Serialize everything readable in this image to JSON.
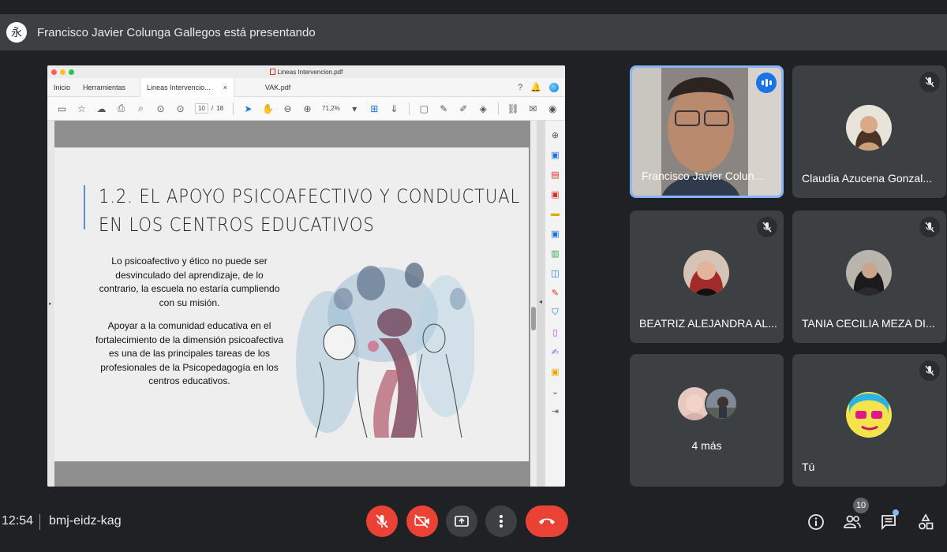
{
  "banner": {
    "presenter_text": "Francisco Javier Colunga Gallegos está presentando",
    "icon_glyph": "永"
  },
  "shared_screen": {
    "window_title": "Lineas Intervencion.pdf",
    "nav": [
      "Inicio",
      "Herramientas"
    ],
    "tabs": [
      {
        "label": "Lineas Intervencio...",
        "close": "×",
        "active": true
      },
      {
        "label": "VAK.pdf",
        "active": false
      }
    ],
    "page_current": "10",
    "page_separator": "/",
    "page_total": "18",
    "zoom": "71,2%",
    "slide": {
      "heading_line1": "1.2. EL APOYO PSICOAFECTIVO Y CONDUCTUAL",
      "heading_line2": "EN LOS CENTROS EDUCATIVOS",
      "paragraph1": "Lo psicoafectivo y ético no puede ser desvinculado del aprendizaje, de lo contrario, la escuela no estaría cumpliendo con su misión.",
      "paragraph2": "Apoyar a la comunidad educativa en el fortalecimiento de la dimensión psicoafectiva es una de las principales tareas de los profesionales de la Psicopedagogía en los centros educativos."
    }
  },
  "participants": [
    {
      "name": "Francisco Javier Colun...",
      "speaking": true
    },
    {
      "name": "Claudia Azucena Gonzal...",
      "muted": true
    },
    {
      "name": "BEATRIZ ALEJANDRA AL...",
      "muted": true
    },
    {
      "name": "TANIA CECILIA MEZA DI...",
      "muted": true
    },
    {
      "name": "4 más"
    },
    {
      "name": "Tú",
      "muted": true
    }
  ],
  "bottom_bar": {
    "time": "12:54",
    "meeting_code": "bmj-eidz-kag",
    "people_count": "10"
  },
  "colors": {
    "background": "#202124",
    "tile": "#3c4043",
    "danger": "#ea4335",
    "accent": "#8ab4f8",
    "speaking": "#1a73e8"
  }
}
